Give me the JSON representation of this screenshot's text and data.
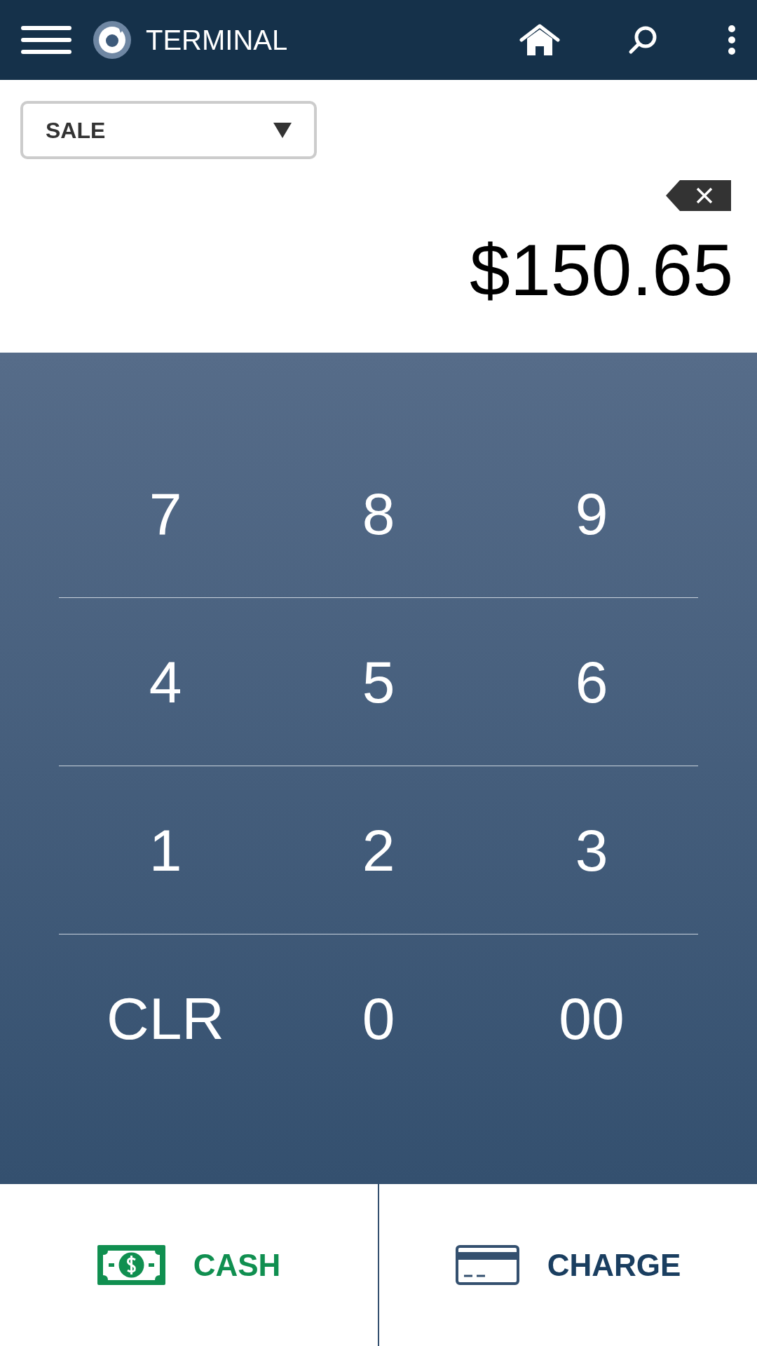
{
  "app_bar": {
    "title": "TERMINAL"
  },
  "transaction_type": {
    "value": "SALE"
  },
  "amount": "$150.65",
  "keypad": [
    [
      "7",
      "8",
      "9"
    ],
    [
      "4",
      "5",
      "6"
    ],
    [
      "1",
      "2",
      "3"
    ],
    [
      "CLR",
      "0",
      "00"
    ]
  ],
  "actions": [
    {
      "label": "CASH",
      "kind": "cash"
    },
    {
      "label": "CHARGE",
      "kind": "card"
    }
  ]
}
